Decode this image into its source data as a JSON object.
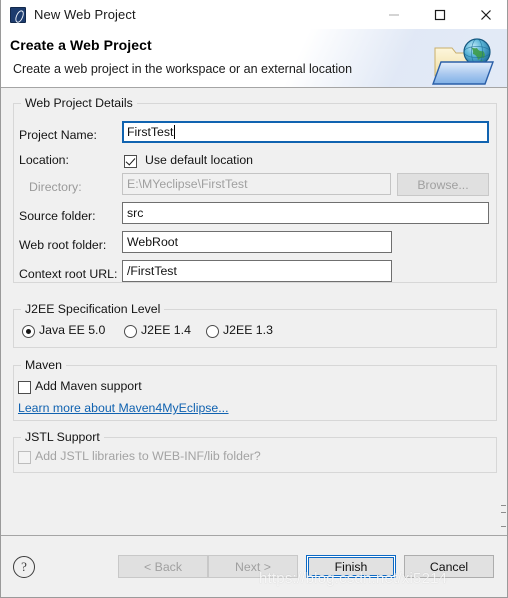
{
  "window": {
    "title": "New Web Project",
    "icon": "myeclipse-logo-icon",
    "controls": {
      "minimize": "minimize-icon",
      "maximize": "maximize-icon",
      "close": "close-icon"
    }
  },
  "header": {
    "title": "Create a Web Project",
    "description": "Create a web project in the workspace or an external location",
    "art": "folder-globe-icon"
  },
  "groups": {
    "web_project_details": {
      "label": "Web Project Details",
      "fields": {
        "project_name": {
          "label": "Project Name:",
          "value": "FirstTest",
          "focused": true
        },
        "location": {
          "label": "Location:",
          "checkbox_label": "Use default location",
          "checked": true
        },
        "directory": {
          "label": "Directory:",
          "value": "E:\\MYeclipse\\FirstTest",
          "disabled": true,
          "browse_label": "Browse..."
        },
        "source_folder": {
          "label": "Source folder:",
          "value": "src"
        },
        "web_root_folder": {
          "label": "Web root folder:",
          "value": "WebRoot"
        },
        "context_root_url": {
          "label": "Context root URL:",
          "value": "/FirstTest"
        }
      }
    },
    "j2ee_spec": {
      "label": "J2EE Specification Level",
      "options": [
        {
          "label": "Java EE 5.0",
          "selected": true
        },
        {
          "label": "J2EE 1.4",
          "selected": false
        },
        {
          "label": "J2EE 1.3",
          "selected": false
        }
      ]
    },
    "maven": {
      "label": "Maven",
      "checkbox_label": "Add Maven support",
      "checked": false,
      "link_label": "Learn more about Maven4MyEclipse..."
    },
    "jstl": {
      "label": "JSTL Support",
      "checkbox_label": "Add JSTL libraries to WEB-INF/lib folder?",
      "checked": false,
      "disabled": true
    }
  },
  "footer": {
    "help": "?",
    "back_label": "< Back",
    "next_label": "Next >",
    "finish_label": "Finish",
    "cancel_label": "Cancel"
  },
  "watermark": "https://blog.csdn.net/xi5214"
}
